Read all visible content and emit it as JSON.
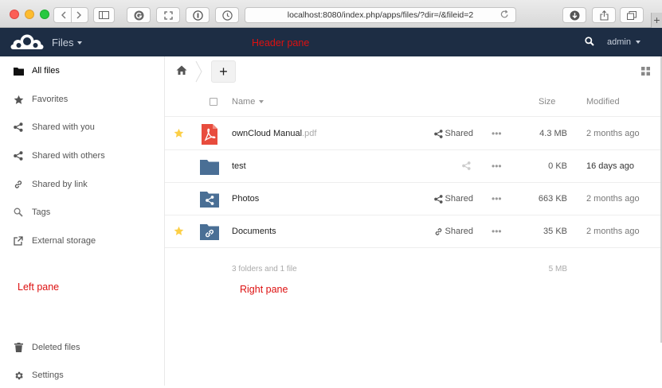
{
  "browser": {
    "url": "localhost:8080/index.php/apps/files/?dir=/&fileid=2"
  },
  "header": {
    "app_name": "Files",
    "user": "admin",
    "pane_label": "Header pane"
  },
  "sidebar": {
    "items": [
      {
        "label": "All files",
        "icon": "folder-icon"
      },
      {
        "label": "Favorites",
        "icon": "star-icon"
      },
      {
        "label": "Shared with you",
        "icon": "share-icon"
      },
      {
        "label": "Shared with others",
        "icon": "share-icon"
      },
      {
        "label": "Shared by link",
        "icon": "link-icon"
      },
      {
        "label": "Tags",
        "icon": "tag-search-icon"
      },
      {
        "label": "External storage",
        "icon": "external-link-icon"
      }
    ],
    "pane_label": "Left pane",
    "bottom": [
      {
        "label": "Deleted files",
        "icon": "trash-icon"
      },
      {
        "label": "Settings",
        "icon": "gear-icon"
      }
    ]
  },
  "main": {
    "pane_label": "Right pane",
    "add_label": "+",
    "columns": {
      "name": "Name",
      "size": "Size",
      "modified": "Modified"
    },
    "files": [
      {
        "name": "ownCloud Manual",
        "ext": ".pdf",
        "favorite": true,
        "share_label": "Shared",
        "size": "4.3 MB",
        "modified": "2 months ago",
        "icon": "pdf-icon"
      },
      {
        "name": "test",
        "ext": "",
        "favorite": false,
        "share_label": "",
        "size": "0 KB",
        "modified": "16 days ago",
        "icon": "folder-icon"
      },
      {
        "name": "Photos",
        "ext": "",
        "favorite": false,
        "share_label": "Shared",
        "size": "663 KB",
        "modified": "2 months ago",
        "icon": "shared-folder-icon"
      },
      {
        "name": "Documents",
        "ext": "",
        "favorite": true,
        "share_label": "Shared",
        "size": "35 KB",
        "modified": "2 months ago",
        "icon": "link-folder-icon"
      }
    ],
    "summary": "3 folders and 1 file",
    "summary_size": "5 MB"
  },
  "colors": {
    "header_bg": "#1d2d44",
    "folder": "#4a6f95",
    "pdf": "#e84c3d",
    "star": "#fccf46",
    "annotation": "#dd1111"
  }
}
